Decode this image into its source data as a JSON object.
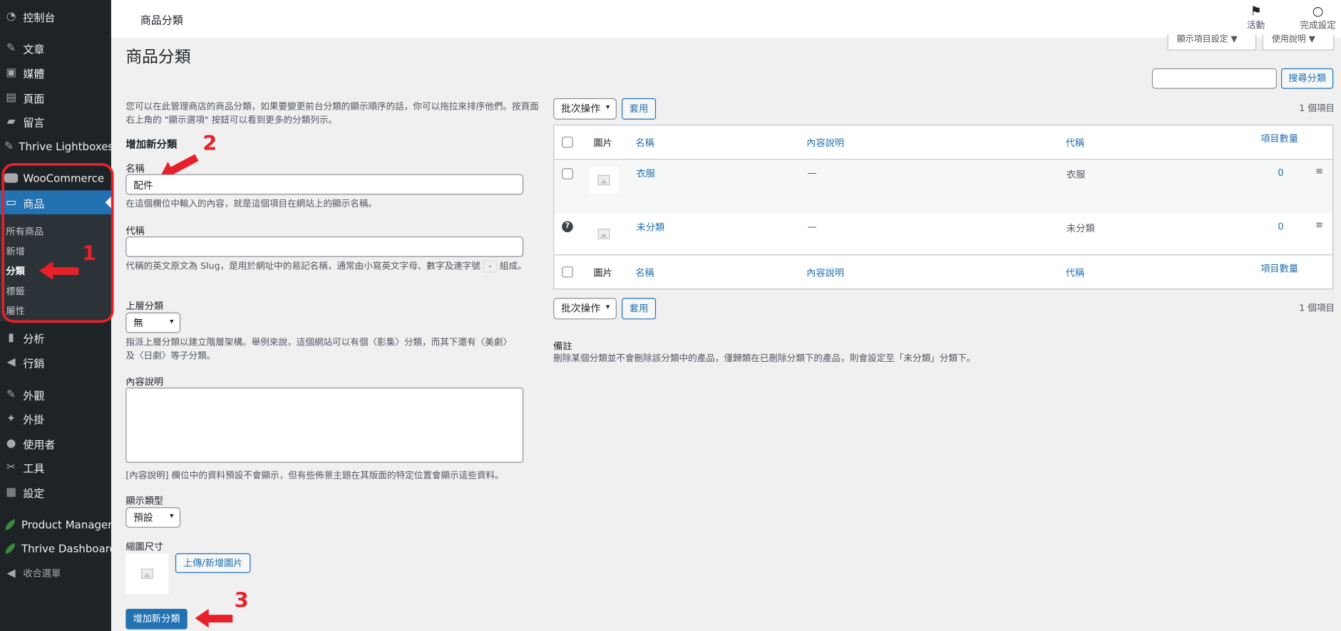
{
  "sidebar": {
    "items": [
      {
        "icon": "dashboard-icon",
        "glyph": "◔",
        "label": "控制台"
      },
      {
        "icon": "pin-icon",
        "glyph": "✎",
        "label": "文章"
      },
      {
        "icon": "media-icon",
        "glyph": "▣",
        "label": "媒體"
      },
      {
        "icon": "page-icon",
        "glyph": "▤",
        "label": "頁面"
      },
      {
        "icon": "comment-icon",
        "glyph": "▰",
        "label": "留言"
      },
      {
        "icon": "pin-icon",
        "glyph": "✎",
        "label": "Thrive Lightboxes"
      },
      {
        "icon": "woocommerce-icon",
        "glyph": "",
        "label": "WooCommerce"
      },
      {
        "icon": "products-icon",
        "glyph": "▭",
        "label": "商品"
      },
      {
        "icon": "analytics-icon",
        "glyph": "▮",
        "label": "分析"
      },
      {
        "icon": "megaphone-icon",
        "glyph": "◀",
        "label": "行銷"
      },
      {
        "icon": "appearance-icon",
        "glyph": "✎",
        "label": "外觀"
      },
      {
        "icon": "plugins-icon",
        "glyph": "✦",
        "label": "外掛"
      },
      {
        "icon": "users-icon",
        "glyph": "●",
        "label": "使用者"
      },
      {
        "icon": "tools-icon",
        "glyph": "✂",
        "label": "工具"
      },
      {
        "icon": "settings-icon",
        "glyph": "▦",
        "label": "設定"
      },
      {
        "icon": "leaf-icon",
        "glyph": "",
        "label": "Product Manager"
      },
      {
        "icon": "leaf-icon",
        "glyph": "",
        "label": "Thrive Dashboard"
      },
      {
        "icon": "collapse-icon",
        "glyph": "◀",
        "label": "收合選單"
      }
    ],
    "submenu": [
      "所有商品",
      "新增",
      "分類",
      "標籤",
      "屬性"
    ]
  },
  "annotations": {
    "step1": "1",
    "step2": "2",
    "step3": "3"
  },
  "topbar": {
    "title": "商品分類",
    "activity": "活動",
    "finish_setup": "完成設定",
    "screen_options": "顯示項目設定 ▼",
    "help": "使用說明 ▼"
  },
  "page": {
    "title": "商品分類",
    "intro": "您可以在此管理商店的商品分類，如果要變更前台分類的顯示順序的話，你可以拖拉來排序他們。按頁面右上角的 \"顯示選項\" 按鈕可以看到更多的分類列示。"
  },
  "form": {
    "heading": "增加新分類",
    "name_label": "名稱",
    "name_value": "配件",
    "name_help": "在這個欄位中輸入的內容，就是這個項目在網站上的顯示名稱。",
    "slug_label": "代稱",
    "slug_value": "",
    "slug_help_pre": "代稱的英文原文為 Slug，是用於網址中的易記名稱，通常由小寫英文字母、數字及連字號",
    "slug_help_dash": "-",
    "slug_help_post": "組成。",
    "parent_label": "上層分類",
    "parent_value": "無",
    "parent_help": "指派上層分類以建立階層架構。舉例來說，這個網站可以有個〈影集〉分類，而其下還有〈美劇〉及〈日劇〉等子分類。",
    "desc_label": "內容說明",
    "desc_value": "",
    "desc_help": "[內容說明] 欄位中的資料預設不會顯示，但有些佈景主題在其版面的特定位置會顯示這些資料。",
    "display_label": "顯示類型",
    "display_value": "預設",
    "thumb_label": "縮圖尺寸",
    "upload_btn": "上傳/新增圖片",
    "submit_btn": "增加新分類"
  },
  "search": {
    "placeholder": "",
    "button": "搜尋分類"
  },
  "bulk": {
    "label": "批次操作",
    "apply": "套用",
    "count": "1 個項目"
  },
  "table": {
    "columns": [
      "圖片",
      "名稱",
      "內容說明",
      "代稱",
      "項目數量"
    ],
    "rows": [
      {
        "name": "衣服",
        "description": "—",
        "slug": "衣服",
        "count": "0"
      },
      {
        "name": "未分類",
        "description": "—",
        "slug": "未分類",
        "count": "0"
      }
    ]
  },
  "note": {
    "title": "備註",
    "text": "刪除某個分類並不會刪除該分類中的產品，僅歸類在已刪除分類下的產品，則會設定至「未分類」分類下。"
  }
}
